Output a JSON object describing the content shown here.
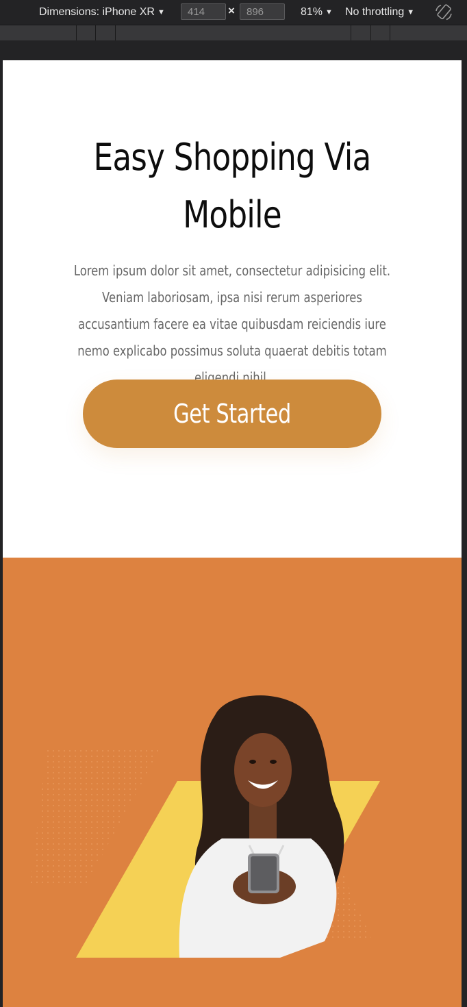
{
  "devtools": {
    "dimensions_label": "Dimensions: iPhone XR",
    "width_value": "414",
    "height_value": "896",
    "times_symbol": "×",
    "zoom_label": "81%",
    "throttling_label": "No throttling",
    "rotate_icon": "rotate-device-icon"
  },
  "hero": {
    "title": "Easy Shopping Via Mobile",
    "description": "Lorem ipsum dolor sit amet, consectetur adipisicing elit. Veniam laboriosam, ipsa nisi rerum asperiores accusantium facere ea vitae quibusdam reiciendis iure nemo explicabo possimus soluta quaerat debitis totam eligendi nihil.",
    "cta_label": "Get Started"
  },
  "colors": {
    "accent_button": "#cd8b3c",
    "promo_background": "#dd8240",
    "promo_shape": "#f5d155"
  }
}
